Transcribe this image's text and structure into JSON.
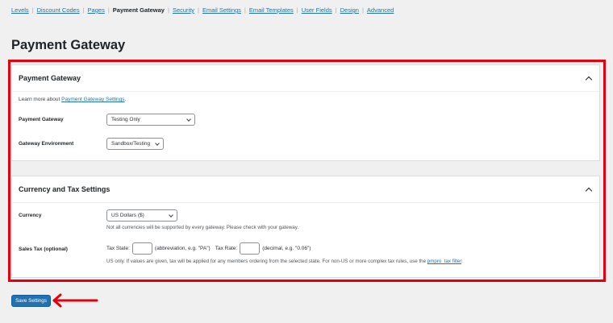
{
  "nav": {
    "items": [
      {
        "label": "Levels",
        "current": false
      },
      {
        "label": "Discount Codes",
        "current": false
      },
      {
        "label": "Pages",
        "current": false
      },
      {
        "label": "Payment Gateway",
        "current": true
      },
      {
        "label": "Security",
        "current": false
      },
      {
        "label": "Email Settings",
        "current": false
      },
      {
        "label": "Email Templates",
        "current": false
      },
      {
        "label": "User Fields",
        "current": false
      },
      {
        "label": "Design",
        "current": false
      },
      {
        "label": "Advanced",
        "current": false
      }
    ],
    "separator": "|"
  },
  "page": {
    "title": "Payment Gateway"
  },
  "gateway_card": {
    "title": "Payment Gateway",
    "intro_prefix": "Learn more about ",
    "intro_link": "Payment Gateway Settings",
    "intro_suffix": ".",
    "gateway_label": "Payment Gateway",
    "gateway_value": "Testing Only",
    "environment_label": "Gateway Environment",
    "environment_value": "Sandbox/Testing"
  },
  "currency_card": {
    "title": "Currency and Tax Settings",
    "currency_label": "Currency",
    "currency_value": "US Dollars ($)",
    "currency_help": "Not all currencies will be supported by every gateway. Please check with your gateway.",
    "tax_label": "Sales Tax (optional)",
    "tax_state_label": "Tax State:",
    "tax_state_value": "",
    "tax_state_hint": "(abbreviation, e.g. \"PA\")",
    "tax_rate_label": "Tax Rate:",
    "tax_rate_value": "",
    "tax_rate_hint": "(decimal, e.g. \"0.06\")",
    "tax_help_prefix": "US only. If values are given, tax will be applied for any members ordering from the selected state. For non-US or more complex tax rules, use the ",
    "tax_help_link": "pmpro_tax filter",
    "tax_help_suffix": "."
  },
  "actions": {
    "save_label": "Save Settings"
  },
  "colors": {
    "accent": "#2271b1",
    "annotation_red": "#e3000f",
    "background": "#f0f0f1"
  }
}
